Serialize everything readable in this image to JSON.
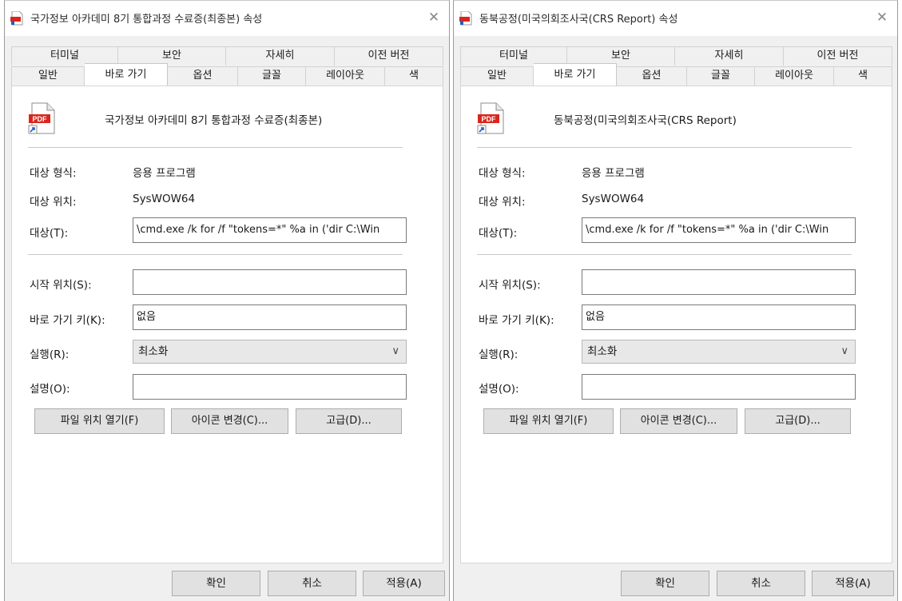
{
  "dialogs": [
    {
      "title": "국가정보 아카데미 8기 통합과정 수료증(최종본) 속성",
      "close_glyph": "✕",
      "tabs_back": [
        "터미널",
        "보안",
        "자세히",
        "이전 버전"
      ],
      "tabs_front": [
        "일반",
        "바로 가기",
        "옵션",
        "글꼴",
        "레이아웃",
        "색"
      ],
      "active_tab": "바로 가기",
      "file_name": "국가정보 아카데미 8기 통합과정 수료증(최종본)",
      "target_type_label": "대상 형식:",
      "target_type_value": "응용 프로그램",
      "target_location_label": "대상 위치:",
      "target_location_value": "SysWOW64",
      "target_label": "대상(T):",
      "target_value": "\\cmd.exe /k for /f \"tokens=*\" %a in ('dir C:\\Win",
      "start_in_label": "시작 위치(S):",
      "start_in_value": "",
      "shortcut_key_label": "바로 가기 키(K):",
      "shortcut_key_value": "없음",
      "run_label": "실행(R):",
      "run_value": "최소화",
      "comment_label": "설명(O):",
      "comment_value": "",
      "btn_open_location": "파일 위치 열기(F)",
      "btn_change_icon": "아이콘 변경(C)...",
      "btn_advanced": "고급(D)...",
      "btn_ok": "확인",
      "btn_cancel": "취소",
      "btn_apply": "적용(A)"
    },
    {
      "title": "동북공정(미국의회조사국(CRS Report) 속성",
      "close_glyph": "✕",
      "tabs_back": [
        "터미널",
        "보안",
        "자세히",
        "이전 버전"
      ],
      "tabs_front": [
        "일반",
        "바로 가기",
        "옵션",
        "글꼴",
        "레이아웃",
        "색"
      ],
      "active_tab": "바로 가기",
      "file_name": "동북공정(미국의회조사국(CRS Report)",
      "target_type_label": "대상 형식:",
      "target_type_value": "응용 프로그램",
      "target_location_label": "대상 위치:",
      "target_location_value": "SysWOW64",
      "target_label": "대상(T):",
      "target_value": "\\cmd.exe /k for /f \"tokens=*\" %a in ('dir C:\\Win",
      "start_in_label": "시작 위치(S):",
      "start_in_value": "",
      "shortcut_key_label": "바로 가기 키(K):",
      "shortcut_key_value": "없음",
      "run_label": "실행(R):",
      "run_value": "최소화",
      "comment_label": "설명(O):",
      "comment_value": "",
      "btn_open_location": "파일 위치 열기(F)",
      "btn_change_icon": "아이콘 변경(C)...",
      "btn_advanced": "고급(D)...",
      "btn_ok": "확인",
      "btn_cancel": "취소",
      "btn_apply": "적용(A)"
    }
  ],
  "icons": {
    "pdf_badge_text": "PDF",
    "title_icon": "pdf-file-icon",
    "shortcut_overlay": "shortcut-arrow-icon",
    "dropdown": "chevron-down-icon"
  },
  "colors": {
    "pdf_red": "#d9261c",
    "shortcut_blue": "#1f5fbf",
    "dialog_bg": "#f0f0f0",
    "panel_bg": "#ffffff"
  }
}
